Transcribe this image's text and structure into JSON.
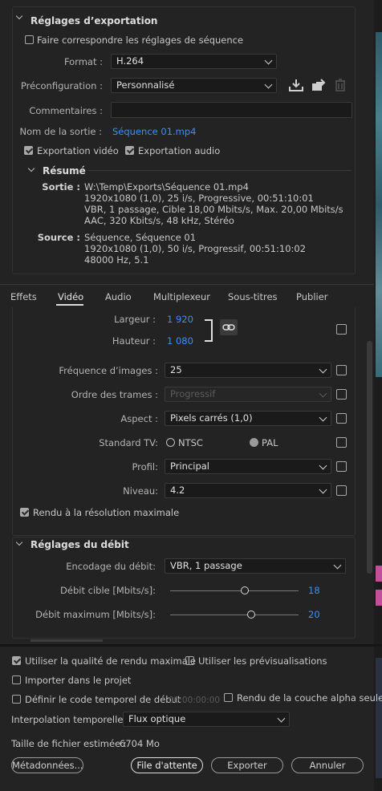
{
  "export_settings": {
    "title": "Réglages d’exportation",
    "match_sequence": "Faire correspondre les réglages de séquence",
    "format_label": "Format :",
    "format_value": "H.264",
    "preset_label": "Préconfiguration :",
    "preset_value": "Personnalisé",
    "comments_label": "Commentaires :",
    "comments_value": "",
    "output_label": "Nom de la sortie :",
    "output_value": "Séquence 01.mp4",
    "export_video": "Exportation vidéo",
    "export_audio": "Exportation audio"
  },
  "summary": {
    "title": "Résumé",
    "output_label": "Sortie :",
    "output_lines": [
      "W:\\Temp\\Exports\\Séquence 01.mp4",
      "1920x1080 (1,0), 25 i/s, Progressive, 00:51:10:01",
      "VBR, 1 passage, Cible 18,00  Mbits/s, Max. 20,00  Mbits/s",
      "AAC, 320  Kbits/s, 48  kHz, Stéréo"
    ],
    "source_label": "Source :",
    "source_lines": [
      "Séquence, Séquence 01",
      "1920x1080 (1,0), 50  i/s, Progressif, 00:51:10:02",
      "48000 Hz, 5.1"
    ]
  },
  "tabs": [
    "Effets",
    "Vidéo",
    "Audio",
    "Multiplexeur",
    "Sous-titres",
    "Publier"
  ],
  "active_tab": "Vidéo",
  "video": {
    "width_label": "Largeur :",
    "width_value": "1 920",
    "height_label": "Hauteur :",
    "height_value": "1 080",
    "fps_label": "Fréquence d’images :",
    "fps_value": "25",
    "field_order_label": "Ordre des trames :",
    "field_order_value": "Progressif",
    "aspect_label": "Aspect :",
    "aspect_value": "Pixels carrés (1,0)",
    "tv_label": "Standard TV:",
    "tv_ntsc": "NTSC",
    "tv_pal": "PAL",
    "profile_label": "Profil:",
    "profile_value": "Principal",
    "level_label": "Niveau:",
    "level_value": "4.2",
    "max_render": "Rendu à la résolution maximale"
  },
  "bitrate": {
    "title": "Réglages du débit",
    "encoding_label": "Encodage du débit:",
    "encoding_value": "VBR, 1 passage",
    "target_label": "Débit cible [Mbits/s]:",
    "target_value": "18",
    "target_fraction": 0.58,
    "max_label": "Débit maximum [Mbits/s]:",
    "max_value": "20",
    "max_fraction": 0.63
  },
  "footer": {
    "max_quality": "Utiliser la qualité de rendu maximale",
    "use_previews": "Utiliser les prévisualisations",
    "import_project": "Importer dans le projet",
    "timecode": "Définir le code temporel de début",
    "timecode_value": "00:00:00:00",
    "alpha": "Rendu de la couche alpha seule",
    "interp_label": "Interpolation temporelle :",
    "interp_value": "Flux optique",
    "filesize_label": "Taille de fichier estimée :",
    "filesize_value": "6704 Mo",
    "metadata_btn": "Métadonnées...",
    "queue_btn": "File d'attente",
    "export_btn": "Exporter",
    "cancel_btn": "Annuler"
  },
  "colors": {
    "accent": "#3d90f5",
    "background": "#232323",
    "timeline_magenta": "#c24f9a"
  }
}
